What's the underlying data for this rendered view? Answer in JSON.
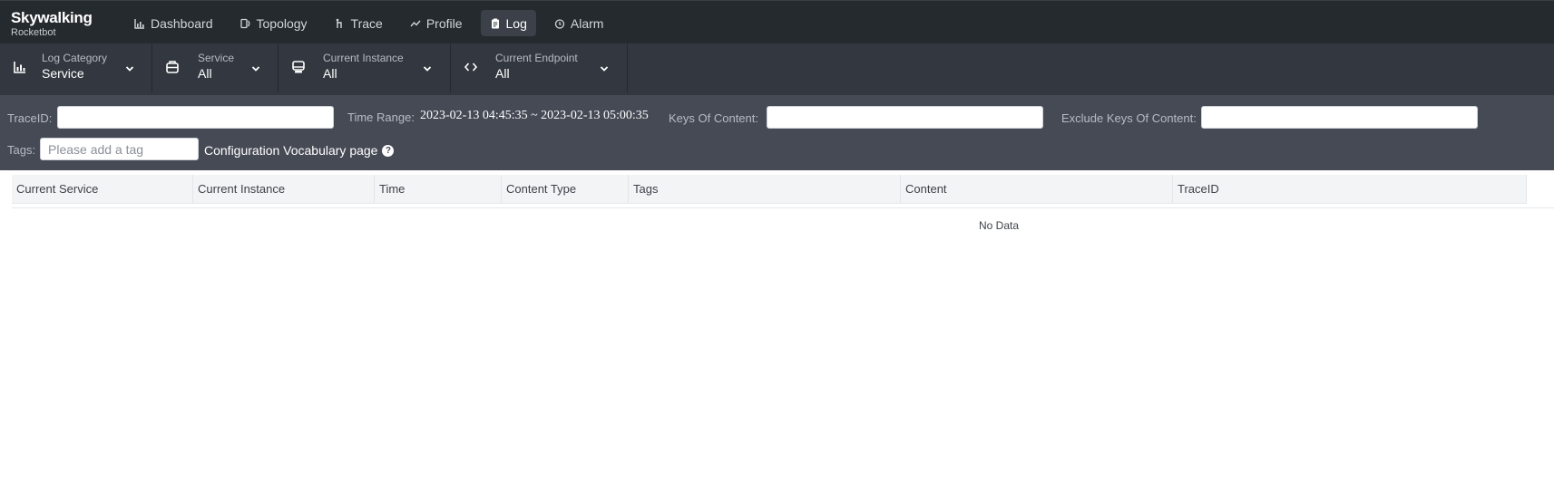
{
  "app": {
    "logo_title": "Skywalking",
    "logo_subtitle": "Rocketbot"
  },
  "nav": [
    {
      "label": "Dashboard",
      "icon": "bar-chart-icon",
      "active": false
    },
    {
      "label": "Topology",
      "icon": "topology-icon",
      "active": false
    },
    {
      "label": "Trace",
      "icon": "trace-icon",
      "active": false
    },
    {
      "label": "Profile",
      "icon": "trend-icon",
      "active": false
    },
    {
      "label": "Log",
      "icon": "clipboard-icon",
      "active": true
    },
    {
      "label": "Alarm",
      "icon": "alarm-clock-icon",
      "active": false
    }
  ],
  "selectors": {
    "log_category": {
      "label": "Log Category",
      "value": "Service",
      "icon": "chart-icon"
    },
    "service": {
      "label": "Service",
      "value": "All",
      "icon": "service-icon"
    },
    "instance": {
      "label": "Current Instance",
      "value": "All",
      "icon": "instance-icon"
    },
    "endpoint": {
      "label": "Current Endpoint",
      "value": "All",
      "icon": "code-icon"
    }
  },
  "filters": {
    "trace_id_label": "TraceID:",
    "trace_id_value": "",
    "time_range_label": "Time Range:",
    "time_range_value": "2023-02-13 04:45:35 ~ 2023-02-13 05:00:35",
    "keys_label": "Keys Of Content:",
    "keys_value": "",
    "exclude_keys_label": "Exclude Keys Of Content:",
    "exclude_keys_value": "",
    "tags_label": "Tags:",
    "tags_placeholder": "Please add a tag",
    "vocab_link": "Configuration Vocabulary page",
    "help_glyph": "?"
  },
  "table": {
    "columns": [
      "Current Service",
      "Current Instance",
      "Time",
      "Content Type",
      "Tags",
      "Content",
      "TraceID"
    ],
    "rows": [],
    "empty_text": "No Data"
  },
  "colors": {
    "topbar": "#252a2f",
    "selector_bar": "#333840",
    "filter_bar": "#454a55",
    "active_nav": "#3b4049"
  }
}
